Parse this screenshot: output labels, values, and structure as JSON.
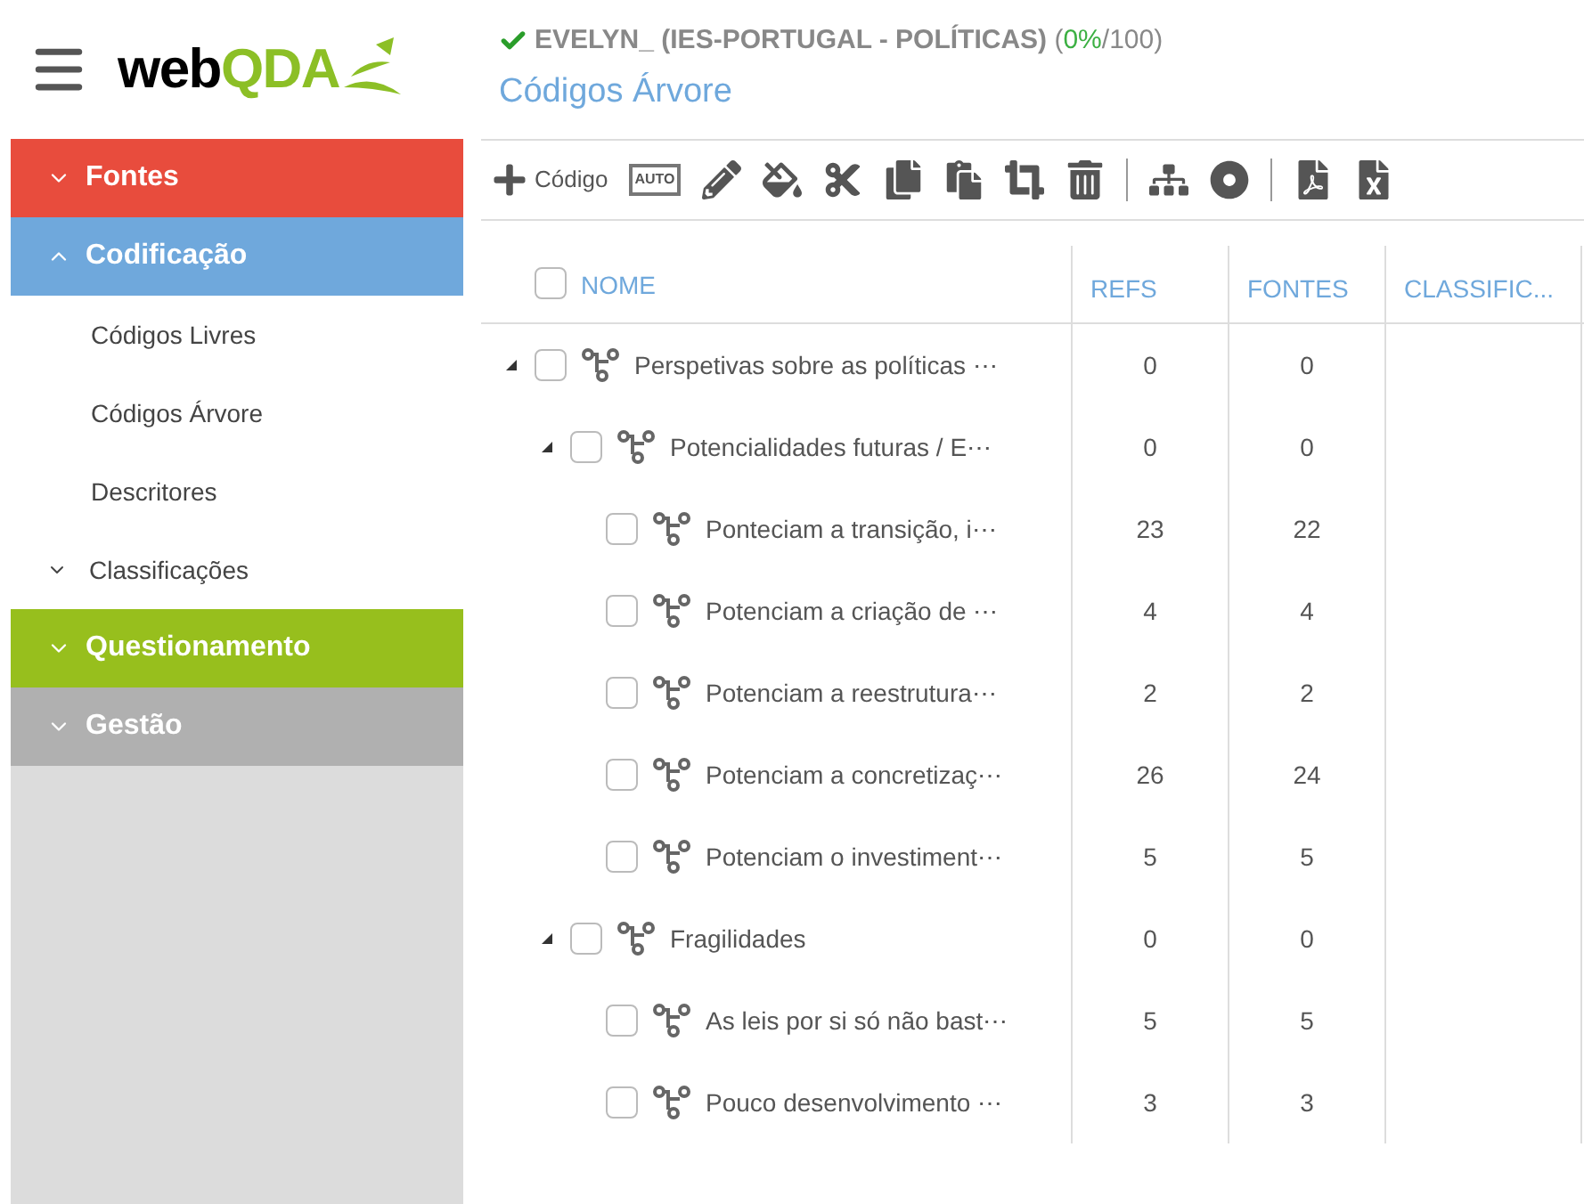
{
  "logo": {
    "part_1": "web",
    "part_2": "QDA"
  },
  "sidebar": {
    "items": [
      {
        "kind": "section",
        "label": "Fontes",
        "color": "#e84c3d",
        "expanded": false
      },
      {
        "kind": "section",
        "label": "Codificação",
        "color": "#6fa8dc",
        "expanded": true
      },
      {
        "kind": "link",
        "label": "Códigos Livres"
      },
      {
        "kind": "link",
        "label": "Códigos Árvore"
      },
      {
        "kind": "link",
        "label": "Descritores"
      },
      {
        "kind": "group",
        "label": "Classificações",
        "expanded": false
      },
      {
        "kind": "section",
        "label": "Questionamento",
        "color": "#97bf1d",
        "expanded": false
      },
      {
        "kind": "section",
        "label": "Gestão",
        "color": "#b0b0b0",
        "expanded": false
      }
    ]
  },
  "project": {
    "name": "EVELYN_ (IES-PORTUGAL - POLÍTICAS)",
    "usage_parts": [
      {
        "kind": "plain",
        "text": "("
      },
      {
        "kind": "ok",
        "text": "0%"
      },
      {
        "kind": "plain",
        "text": "/100)"
      }
    ]
  },
  "page_title": "Códigos Árvore",
  "toolbar": {
    "add_label": "Código",
    "auto_label": "AUTO"
  },
  "table": {
    "columns": [
      "NOME",
      "REFS",
      "FONTES",
      "CLASSIFIC..."
    ],
    "header_checked": false,
    "rows": [
      {
        "name": "Perspetivas sobre as políticas ⋯",
        "refs": "0",
        "fontes": "0",
        "checked": false,
        "expanded": true,
        "children": [
          {
            "name": "Potencialidades futuras / E⋯",
            "refs": "0",
            "fontes": "0",
            "checked": false,
            "expanded": true,
            "children": [
              {
                "name": "Ponteciam a transição, i⋯",
                "refs": "23",
                "fontes": "22",
                "checked": false
              },
              {
                "name": "Potenciam a criação de ⋯",
                "refs": "4",
                "fontes": "4",
                "checked": false
              },
              {
                "name": "Potenciam a reestrutura⋯",
                "refs": "2",
                "fontes": "2",
                "checked": false
              },
              {
                "name": "Potenciam a concretizaç⋯",
                "refs": "26",
                "fontes": "24",
                "checked": false
              },
              {
                "name": "Potenciam o investiment⋯",
                "refs": "5",
                "fontes": "5",
                "checked": false
              }
            ]
          },
          {
            "name": "Fragilidades",
            "refs": "0",
            "fontes": "0",
            "checked": false,
            "expanded": true,
            "children": [
              {
                "name": "As leis por si só não bast⋯",
                "refs": "5",
                "fontes": "5",
                "checked": false
              },
              {
                "name": "Pouco desenvolvimento ⋯",
                "refs": "3",
                "fontes": "3",
                "checked": false
              }
            ]
          }
        ]
      }
    ]
  }
}
